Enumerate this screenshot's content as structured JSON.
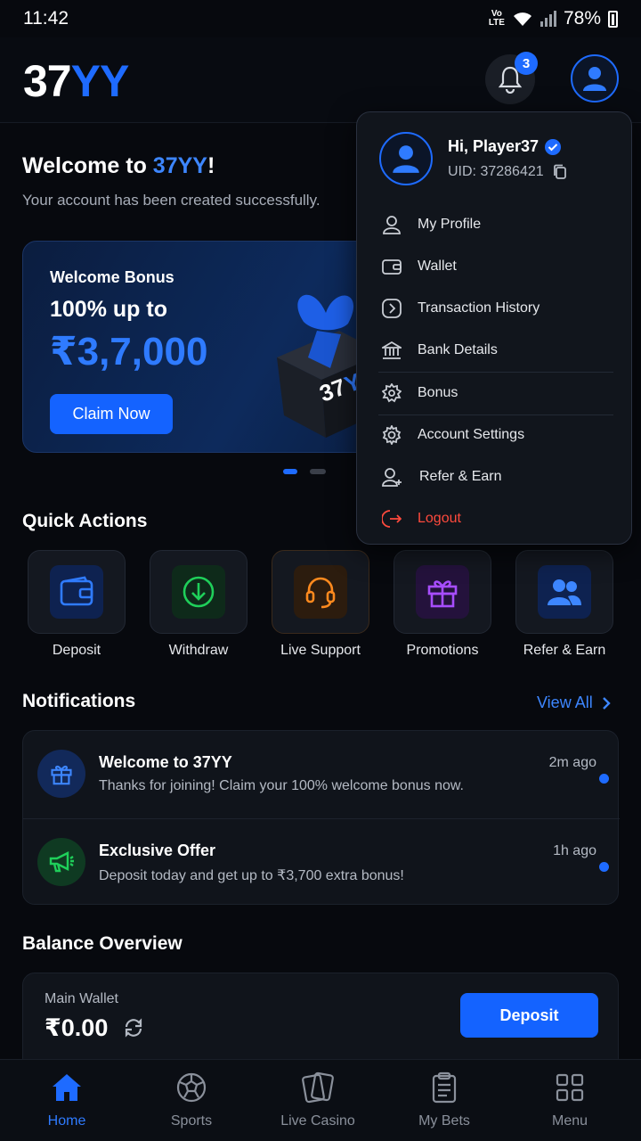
{
  "status_bar": {
    "time": "11:42",
    "battery": "78%"
  },
  "header": {
    "logo_part1": "37",
    "logo_part2": "YY",
    "notification_count": "3"
  },
  "welcome": {
    "title_prefix": "Welcome to ",
    "title_brand": "37YY",
    "title_suffix": "!",
    "subtitle": "Your account has been created successfully."
  },
  "banner": {
    "label": "Welcome Bonus",
    "subtitle": "100% up to",
    "amount": "₹3,7,000",
    "cta": "Claim Now",
    "gift_brand": "37YY"
  },
  "quick_actions": {
    "title": "Quick Actions",
    "items": [
      {
        "label": "Deposit",
        "icon": "wallet-icon",
        "color": "#1e6bff"
      },
      {
        "label": "Withdraw",
        "icon": "download-circle-icon",
        "color": "#1fcf5a"
      },
      {
        "label": "Live Support",
        "icon": "headset-icon",
        "color": "#ff8a1e"
      },
      {
        "label": "Promotions",
        "icon": "gift-icon",
        "color": "#a74dff"
      },
      {
        "label": "Refer & Earn",
        "icon": "users-icon",
        "color": "#3d86ff"
      }
    ]
  },
  "notifications": {
    "title": "Notifications",
    "view_all": "View All",
    "items": [
      {
        "title": "Welcome to 37YY",
        "desc": "Thanks for joining! Claim your 100% welcome bonus now.",
        "time": "2m ago",
        "icon": "gift-icon"
      },
      {
        "title": "Exclusive Offer",
        "desc": "Deposit today and get up to ₹3,700 extra bonus!",
        "time": "1h ago",
        "icon": "megaphone-icon"
      }
    ]
  },
  "balance": {
    "title": "Balance Overview",
    "wallet_label": "Main Wallet",
    "amount": "₹0.00",
    "cta": "Deposit"
  },
  "bottom_nav": {
    "items": [
      {
        "label": "Home",
        "icon": "home-icon",
        "active": true
      },
      {
        "label": "Sports",
        "icon": "soccer-ball-icon",
        "active": false
      },
      {
        "label": "Live Casino",
        "icon": "cards-icon",
        "active": false
      },
      {
        "label": "My Bets",
        "icon": "clipboard-icon",
        "active": false
      },
      {
        "label": "Menu",
        "icon": "grid-icon",
        "active": false
      }
    ]
  },
  "profile_menu": {
    "greeting": "Hi, Player37",
    "uid": "UID: 37286421",
    "items": [
      {
        "label": "My Profile",
        "icon": "user-icon"
      },
      {
        "label": "Wallet",
        "icon": "wallet-icon"
      },
      {
        "label": "Transaction History",
        "icon": "history-icon"
      },
      {
        "label": "Bank Details",
        "icon": "bank-icon"
      },
      {
        "label": "Bonus",
        "icon": "bonus-icon"
      },
      {
        "label": "Account Settings",
        "icon": "gear-icon"
      },
      {
        "label": "Refer & Earn",
        "icon": "user-plus-icon"
      },
      {
        "label": "Logout",
        "icon": "logout-icon"
      }
    ]
  },
  "colors": {
    "accent": "#1e6bff",
    "background": "#07090e",
    "danger": "#ff4a3d"
  }
}
